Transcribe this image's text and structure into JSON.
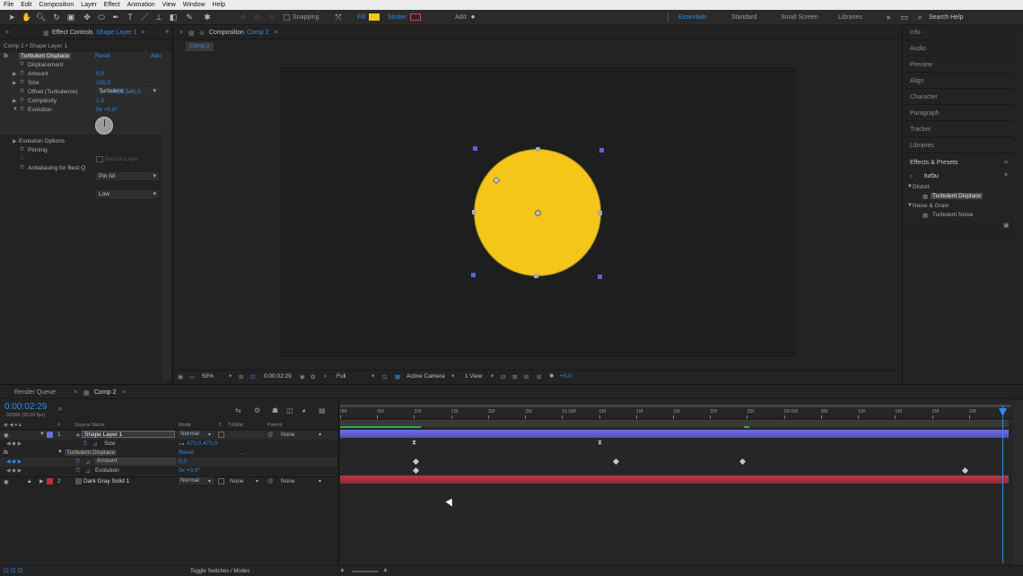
{
  "menu": [
    "File",
    "Edit",
    "Composition",
    "Layer",
    "Effect",
    "Animation",
    "View",
    "Window",
    "Help"
  ],
  "toolbar": {
    "snapping": "Snapping",
    "fill": "Fill:",
    "stroke": "Stroke:",
    "add": "Add:",
    "workspaces": [
      "Essentials",
      "Standard",
      "Small Screen",
      "Libraries"
    ],
    "search_help": "Search Help",
    "fill_color": "#f5c518",
    "stroke_color": "#d14545"
  },
  "effect_controls": {
    "tab_label": "Effect Controls",
    "tab_layer": "Shape Layer 1",
    "breadcrumb": "Comp 2 • Shape Layer 1",
    "effect_name": "Turbulent Displace",
    "reset": "Reset",
    "about": "Abo",
    "rows": [
      {
        "label": "Displacement",
        "value": "Turbulent"
      },
      {
        "label": "Amount",
        "value": "0,0"
      },
      {
        "label": "Size",
        "value": "100,0"
      },
      {
        "label": "Offset (Turbulence)",
        "value": "960,0,540,0"
      },
      {
        "label": "Complexity",
        "value": "1,0"
      },
      {
        "label": "Evolution",
        "value": "0x +0,0°"
      }
    ],
    "evolution_options": "Evolution Options",
    "pinning_label": "Pinning",
    "pinning_value": "Pin All",
    "resize_layer": "Resize Layer",
    "antialiasing_label": "Antialiasing for Best Q",
    "antialiasing_value": "Low"
  },
  "composition": {
    "tab_label": "Composition",
    "tab_name": "Comp 2",
    "sub_tab": "Comp 2",
    "circle_color": "#f5c518",
    "zoom": "50%",
    "timecode": "0:00:02:29",
    "resolution": "Full",
    "camera": "Active Camera",
    "views": "1 View",
    "exposure": "+0,0"
  },
  "right_panel": {
    "items": [
      "Info",
      "Audio",
      "Preview",
      "Align",
      "Character",
      "Paragraph",
      "Tracker",
      "Libraries"
    ],
    "effects_presets": "Effects & Presets",
    "search_value": "turbu",
    "tree": [
      {
        "group": "Distort",
        "item": "Turbulent Displace"
      },
      {
        "group": "Noise & Grain",
        "item": "Turbulent Noise"
      }
    ]
  },
  "timeline": {
    "tab_render_queue": "Render Queue",
    "tab_comp": "Comp 2",
    "timecode": "0:00:02:29",
    "frame_info": "00089 (30.00 fps)",
    "col_source_name": "Source Name",
    "col_mode": "Mode",
    "col_t": "T",
    "col_trkmat": "TrkMat",
    "col_parent": "Parent",
    "layers": [
      {
        "num": "1",
        "name": "Shape Layer 1",
        "mode": "Normal",
        "trkmat": "",
        "parent": "None",
        "color": "#6a6ad8"
      },
      {
        "num": "2",
        "name": "Dark Gray Solid 1",
        "mode": "Normal",
        "trkmat": "None",
        "parent": "None",
        "color": "#c0303a"
      }
    ],
    "size_label": "Size",
    "size_value": "470,0,470,0",
    "effect_label": "Turbulent Displace",
    "effect_reset": "Reset",
    "amount_label": "Amount",
    "amount_value": "0,0",
    "evolution_label": "Evolution",
    "evolution_value": "0x +0,0°",
    "ruler": [
      "00f",
      "05f",
      "10f",
      "15f",
      "20f",
      "25f",
      "01:00f",
      "05f",
      "10f",
      "15f",
      "20f",
      "25f",
      "02:00f",
      "05f",
      "10f",
      "15f",
      "20f",
      "25f"
    ],
    "toggle_switches": "Toggle Switches / Modes"
  }
}
